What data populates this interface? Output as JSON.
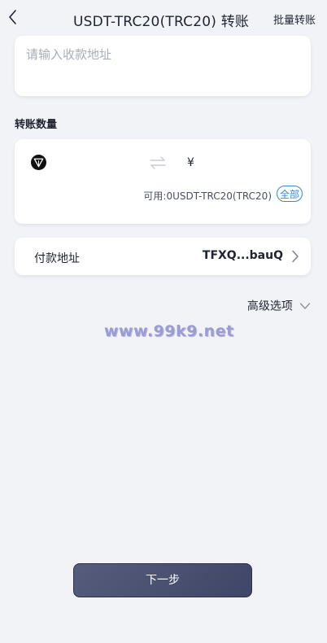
{
  "header": {
    "title": "USDT-TRC20(TRC20) 转账",
    "batch_label": "批量转账"
  },
  "address": {
    "placeholder": "请输入收款地址",
    "value": ""
  },
  "amount": {
    "section_label": "转账数量",
    "token_icon": "tron-token-icon",
    "swap_icon": "swap-arrows-icon",
    "currency_symbol": "¥",
    "available_text": "可用:0USDT-TRC20(TRC20)",
    "all_label": "全部"
  },
  "payment": {
    "label": "付款地址",
    "value": "TFXQ...bauQ"
  },
  "advanced": {
    "label": "高级选项"
  },
  "watermark": "www.99k9.net",
  "next_button": "下一步",
  "colors": {
    "background": "#f2f3f7",
    "card": "#ffffff",
    "accent_blue": "#2f8dd9",
    "button": "#4a5070",
    "watermark": "#9b9bd6"
  }
}
